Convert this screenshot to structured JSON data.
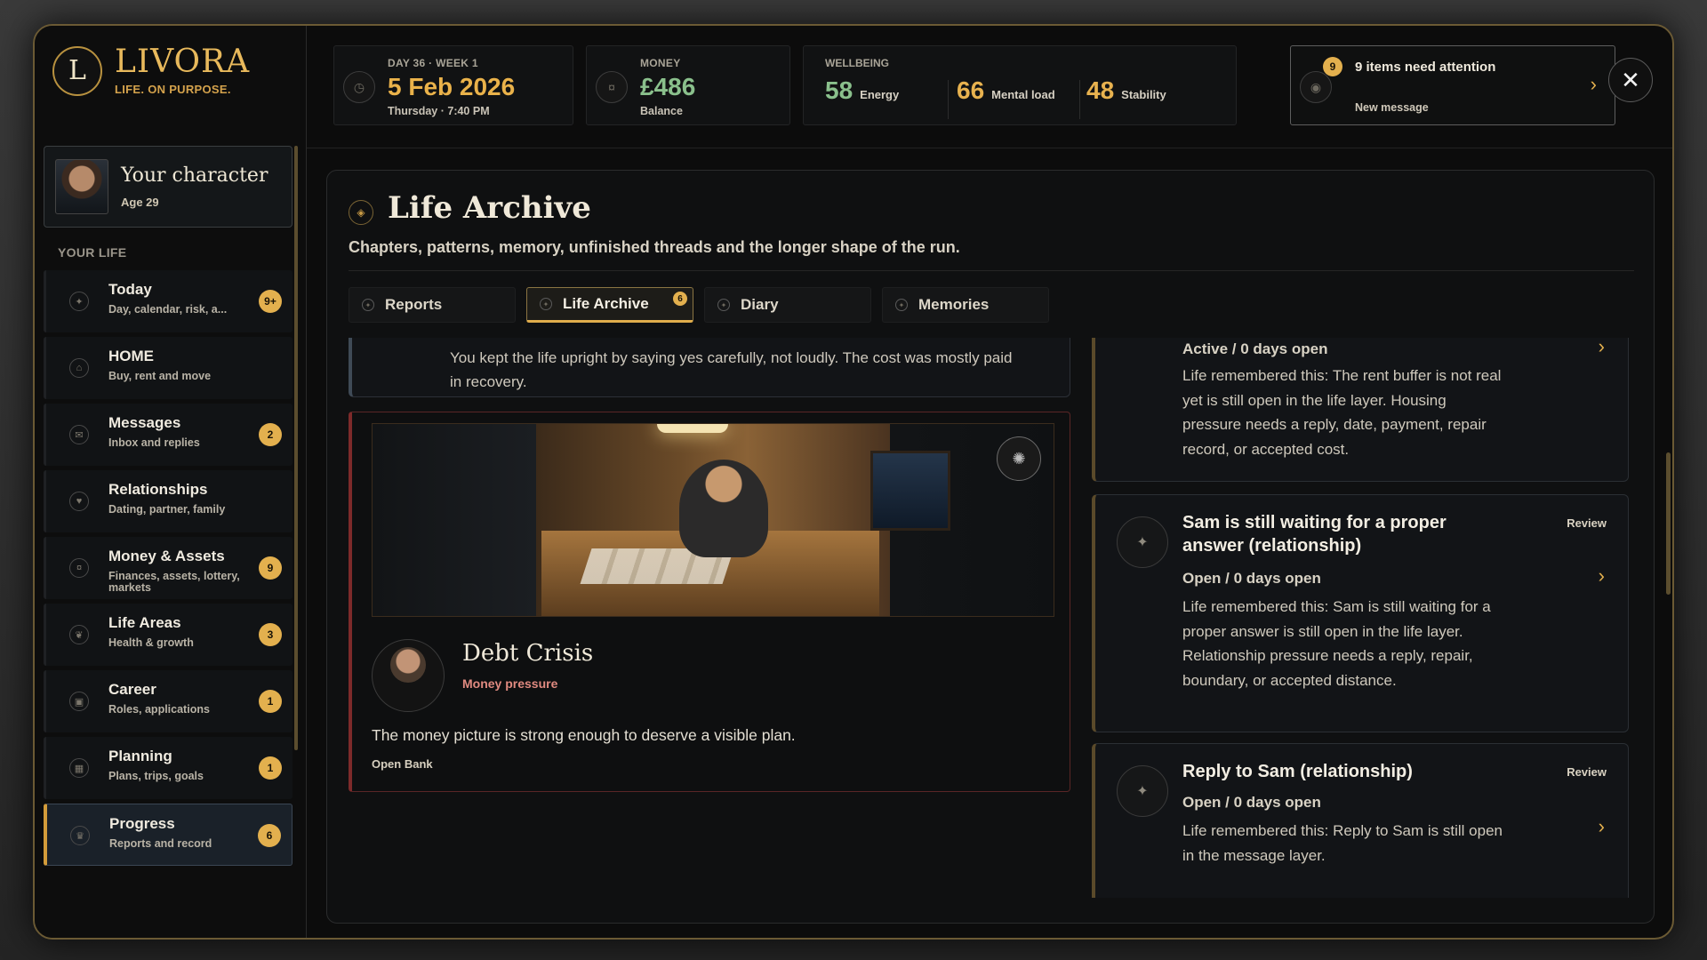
{
  "brand": {
    "logo_letter": "L",
    "name": "LIVORA",
    "tagline": "LIFE. ON PURPOSE."
  },
  "character": {
    "title": "Your character",
    "age": "Age 29"
  },
  "sidebar": {
    "section_label": "YOUR LIFE",
    "items": [
      {
        "title": "Today",
        "sub": "Day, calendar, risk, a...",
        "badge": "9+",
        "icon": "sun-icon"
      },
      {
        "title": "HOME",
        "sub": "Buy, rent and move",
        "badge": "",
        "icon": "house-icon"
      },
      {
        "title": "Messages",
        "sub": "Inbox and replies",
        "badge": "2",
        "icon": "message-icon"
      },
      {
        "title": "Relationships",
        "sub": "Dating, partner, family",
        "badge": "",
        "icon": "heart-icon"
      },
      {
        "title": "Money & Assets",
        "sub": "Finances, assets, lottery, markets",
        "badge": "9",
        "icon": "coin-icon"
      },
      {
        "title": "Life Areas",
        "sub": "Health & growth",
        "badge": "3",
        "icon": "leaf-icon"
      },
      {
        "title": "Career",
        "sub": "Roles, applications",
        "badge": "1",
        "icon": "briefcase-icon"
      },
      {
        "title": "Planning",
        "sub": "Plans, trips, goals",
        "badge": "1",
        "icon": "calendar-icon"
      },
      {
        "title": "Progress",
        "sub": "Reports and record",
        "badge": "6",
        "icon": "trophy-icon",
        "active": true
      }
    ]
  },
  "topbar": {
    "date": {
      "label": "DAY 36 · WEEK 1",
      "value": "5 Feb 2026",
      "sub": "Thursday · 7:40 PM"
    },
    "money": {
      "label": "MONEY",
      "value": "£486",
      "sub": "Balance"
    },
    "wellbeing": {
      "label": "WELLBEING",
      "energy": {
        "value": "58",
        "name": "Energy",
        "color": "#8ac08c"
      },
      "mental": {
        "value": "66",
        "name": "Mental load",
        "color": "#e8b24f"
      },
      "stability": {
        "value": "48",
        "name": "Stability",
        "color": "#e8b24f"
      }
    },
    "alert": {
      "count": "9",
      "title": "9 items need attention",
      "sub": "New message"
    },
    "close_symbol": "✕"
  },
  "panel": {
    "title": "Life Archive",
    "subtitle": "Chapters, patterns, memory, unfinished threads and the longer shape of the run.",
    "tabs": [
      {
        "label": "Reports",
        "badge": ""
      },
      {
        "label": "Life Archive",
        "badge": "6",
        "active": true
      },
      {
        "label": "Diary",
        "badge": ""
      },
      {
        "label": "Memories",
        "badge": ""
      }
    ]
  },
  "archive": {
    "quote": "You kept the life upright by saying yes carefully, not loudly. The cost was mostly paid in recovery.",
    "event": {
      "title": "Debt Crisis",
      "tag": "Money pressure",
      "description": "The money picture is strong enough to deserve a visible plan.",
      "link": "Open Bank"
    }
  },
  "threads": [
    {
      "title": "",
      "status": "Active / 0 days open",
      "body": "Life remembered this: The rent buffer is not real yet is still open in the life layer. Housing pressure needs a reply, date, payment, repair record, or accepted cost.",
      "review": ""
    },
    {
      "title": "Sam is still waiting for a proper answer (relationship)",
      "status": "Open / 0 days open",
      "body": "Life remembered this: Sam is still waiting for a proper answer is still open in the life layer. Relationship pressure needs a reply, repair, boundary, or accepted distance.",
      "review": "Review"
    },
    {
      "title": "Reply to Sam (relationship)",
      "status": "Open / 0 days open",
      "body": "Life remembered this: Reply to Sam is still open in the message layer.",
      "review": "Review"
    }
  ]
}
